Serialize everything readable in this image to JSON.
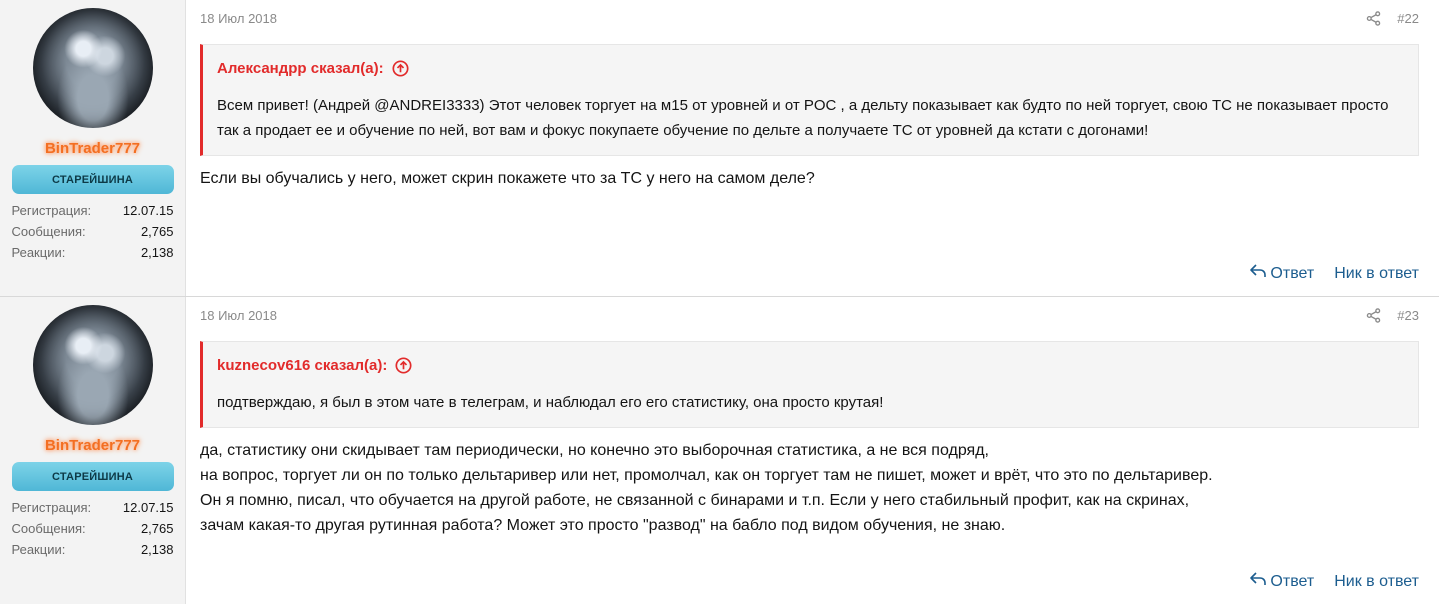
{
  "posts": [
    {
      "user": {
        "username": "BinTrader777",
        "badge": "СТАРЕЙШИНА",
        "stats": [
          {
            "label": "Регистрация:",
            "value": "12.07.15"
          },
          {
            "label": "Сообщения:",
            "value": "2,765"
          },
          {
            "label": "Реакции:",
            "value": "2,138"
          }
        ]
      },
      "date": "18 Июл 2018",
      "number": "#22",
      "quote": {
        "author": "Александрр сказал(а):",
        "text": "Всем привет! (Андрей @ANDREI3333) Этот человек торгует на м15 от уровней и от POC , а дельту показывает как будто по ней торгует, свою ТС не показывает просто так а продает ее и обучение по ней, вот вам и фокус покупаете обучение по дельте а получаете ТС от уровней да кстати с догонами!"
      },
      "message_lines": [
        "Если вы обучались у него, может скрин покажете что за ТС у него на самом деле?"
      ],
      "reply_label": "Ответ",
      "nick_label": "Ник в ответ"
    },
    {
      "user": {
        "username": "BinTrader777",
        "badge": "СТАРЕЙШИНА",
        "stats": [
          {
            "label": "Регистрация:",
            "value": "12.07.15"
          },
          {
            "label": "Сообщения:",
            "value": "2,765"
          },
          {
            "label": "Реакции:",
            "value": "2,138"
          }
        ]
      },
      "date": "18 Июл 2018",
      "number": "#23",
      "quote": {
        "author": "kuznecov616 сказал(а):",
        "text": "подтверждаю, я был в этом чате в телеграм, и наблюдал его его статистику, она просто крутая!"
      },
      "message_lines": [
        "да, статистику они скидывает там периодически, но конечно это выборочная статистика, а не вся подряд,",
        "на вопрос, торгует ли он по только дельтаривер или нет, промолчал, как он торгует там не пишет, может и врёт, что это по дельтаривер.",
        "Он я помню, писал, что обучается на другой работе, не связанной с бинарами и т.п. Если у него стабильный профит, как на скринах,",
        "зачам какая-то другая рутинная работа? Может это просто \"развод\" на бабло под видом обучения, не знаю."
      ],
      "reply_label": "Ответ",
      "nick_label": "Ник в ответ"
    }
  ],
  "colors": {
    "username": "#f36f22",
    "quote_accent": "#e22b2b",
    "link": "#1c5d8f",
    "badge": "#5fc3df"
  },
  "icons": [
    "share-icon",
    "arrow-up-circle-icon",
    "reply-arrow-icon"
  ]
}
